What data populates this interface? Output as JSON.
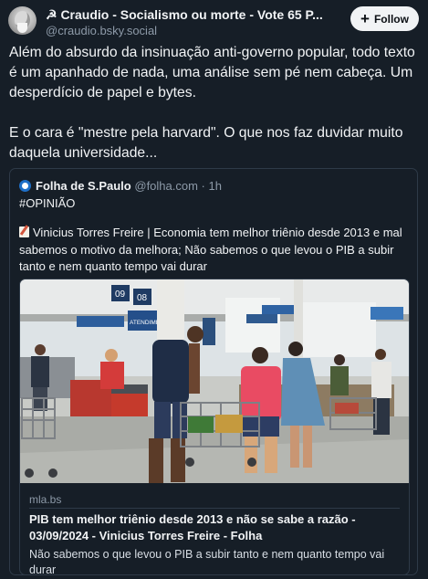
{
  "post": {
    "author_name": "☭ Craudio - Socialismo ou morte - Vote 65 P...",
    "author_handle": "@craudio.bsky.social",
    "follow_label": "Follow",
    "paragraphs": [
      "Além do absurdo da insinuação anti-governo popular, todo texto é um apanhado de nada, uma análise sem pé nem cabeça. Um desperdício de papel e bytes.",
      "E o cara é \"mestre pela harvard\". O que nos faz duvidar muito daquela universidade..."
    ]
  },
  "quote": {
    "author_name": "Folha de S.Paulo",
    "author_handle": "@folha.com",
    "separator": " · ",
    "time": "1h",
    "tag": "#OPINIÃO",
    "text": "Vinicius Torres Freire | Economia tem melhor triênio desde 2013 e mal sabemos o motivo da melhora; Não sabemos o que levou o PIB a subir tanto e nem quanto tempo vai durar",
    "link": {
      "domain": "mla.bs",
      "title": "PIB tem melhor triênio desde 2013 e não se sabe a razão - 03/09/2024 - Vinicius Torres Freire - Folha",
      "description": "Não sabemos o que levou o PIB a subir tanto e nem quanto tempo vai durar",
      "image_signs": [
        "09",
        "08",
        "ATENDIME"
      ]
    }
  },
  "icons": {
    "hammer_sickle": "hammer-sickle-icon",
    "memo": "memo-icon",
    "plus": "plus-icon"
  },
  "colors": {
    "background": "#161e27",
    "text": "#f1f3f5",
    "muted": "#8d9aa8",
    "border": "#2e3a48",
    "follow_bg": "#f1f3f5",
    "folha_blue": "#1e6fc7"
  }
}
